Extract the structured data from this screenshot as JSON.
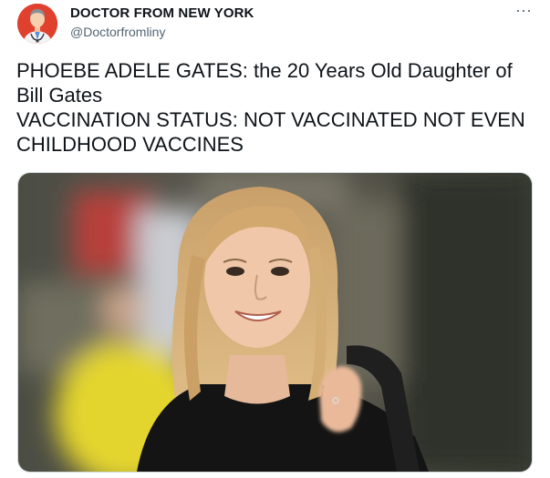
{
  "author": {
    "display_name": "DOCTOR FROM NEW YORK",
    "handle": "@Doctorfromliny",
    "avatar_icon": "doctor-avatar-icon"
  },
  "more_icon": "more-options-icon",
  "tweet": {
    "line1": "PHOEBE ADELE GATES: the 20 Years Old Daughter of Bill Gates",
    "line2": "VACCINATION STATUS: NOT VACCINATED NOT EVEN CHILDHOOD VACCINES"
  },
  "media": {
    "description_icon": "photo-of-smiling-blonde-woman"
  },
  "colors": {
    "name": "#0f1419",
    "handle": "#536471",
    "avatar_bg": "#e0412f",
    "border": "#cfd9de"
  }
}
